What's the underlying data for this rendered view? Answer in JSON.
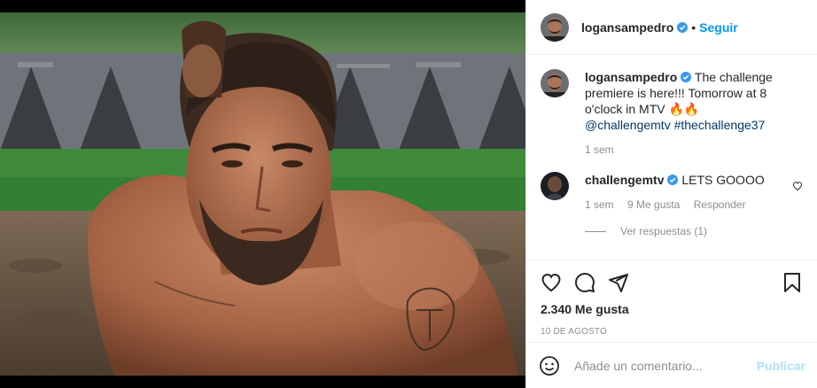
{
  "header": {
    "username": "logansampedro",
    "dot": "•",
    "follow_label": "Seguir"
  },
  "caption": {
    "username": "logansampedro",
    "text": "The challenge premiere is here!!! Tomorrow at 8 o'clock in MTV",
    "emoji": "🔥🔥",
    "mention": "@challengemtv",
    "hashtag": "#thechallenge37",
    "time": "1 sem"
  },
  "comment": {
    "username": "challengemtv",
    "text": "LETS GOOOO",
    "time": "1 sem",
    "likes": "9 Me gusta",
    "reply_label": "Responder",
    "view_replies": "Ver respuestas (1)"
  },
  "post": {
    "likes": "2.340 Me gusta",
    "date": "10 DE AGOSTO"
  },
  "add_comment": {
    "placeholder": "Añade un comentario...",
    "publish_label": "Publicar"
  },
  "colors": {
    "accent": "#0095f6",
    "verified": "#3897f0",
    "publish_disabled": "#b2dffc"
  }
}
